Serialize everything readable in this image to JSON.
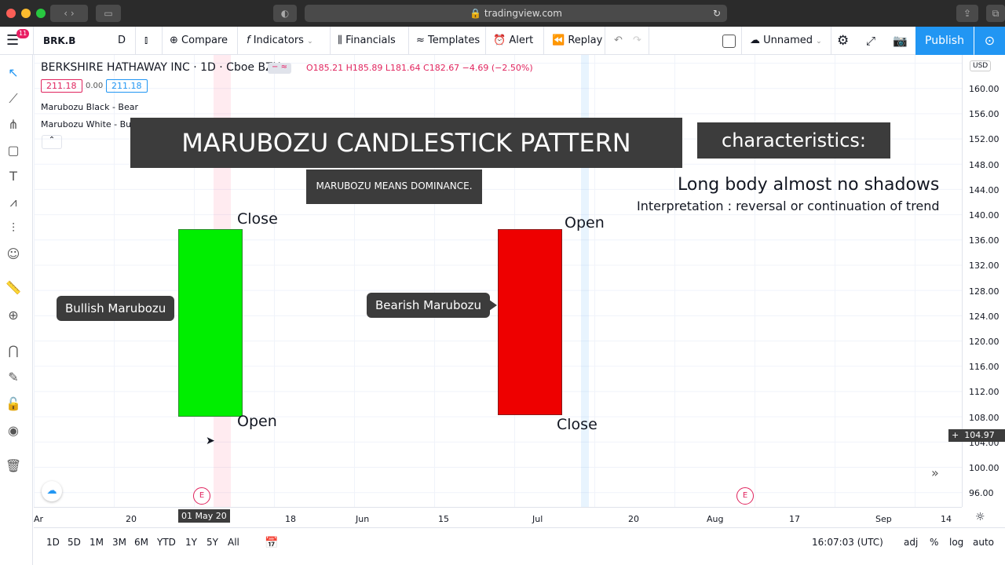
{
  "browser": {
    "url": "tradingview.com"
  },
  "toolbar": {
    "menu_badge": "11",
    "symbol": "BRK.B",
    "interval": "D",
    "compare": "Compare",
    "indicators": "Indicators",
    "financials": "Financials",
    "templates": "Templates",
    "alert": "Alert",
    "replay": "Replay",
    "layout_name": "Unnamed",
    "publish": "Publish"
  },
  "legend": {
    "title": "BERKSHIRE HATHAWAY INC · 1D · Cboe BZX",
    "ohlc": "O185.21 H185.89 L181.64 C182.67 −4.69 (−2.50%)",
    "bid": "211.18",
    "spread": "0.00",
    "ask": "211.18",
    "indicator1": "Marubozu Black - Bear",
    "indicator2": "Marubozu White - Bull"
  },
  "overlay": {
    "title": "MARUBOZU CANDLESTICK PATTERN",
    "subtitle": "MARUBOZU MEANS DOMINANCE.",
    "characteristics": "characteristics:",
    "line1": "Long body almost no shadows",
    "line2": "Interpretation : reversal or continuation of trend",
    "bullish": "Bullish Marubozu",
    "bearish": "Bearish Marubozu",
    "bull_close": "Close",
    "bull_open": "Open",
    "bear_open": "Open",
    "bear_close": "Close",
    "bull_color": "#00ee00",
    "bear_color": "#ee0000"
  },
  "price_axis": {
    "currency": "USD",
    "ticks": [
      "160.00",
      "156.00",
      "152.00",
      "148.00",
      "144.00",
      "140.00",
      "136.00",
      "132.00",
      "128.00",
      "124.00",
      "120.00",
      "116.00",
      "112.00",
      "108.00",
      "104.00",
      "100.00",
      "96.00"
    ],
    "current": "104.97"
  },
  "time_axis": {
    "ticks": [
      "Ar",
      "20",
      "18",
      "Jun",
      "15",
      "Jul",
      "20",
      "Aug",
      "17",
      "Sep",
      "14"
    ],
    "crosshair": "01 May 20",
    "earnings": "E"
  },
  "bottom": {
    "ranges": [
      "1D",
      "5D",
      "1M",
      "3M",
      "6M",
      "YTD",
      "1Y",
      "5Y",
      "All"
    ],
    "clock": "16:07:03 (UTC)",
    "adj": "adj",
    "pct": "%",
    "log": "log",
    "auto": "auto"
  }
}
